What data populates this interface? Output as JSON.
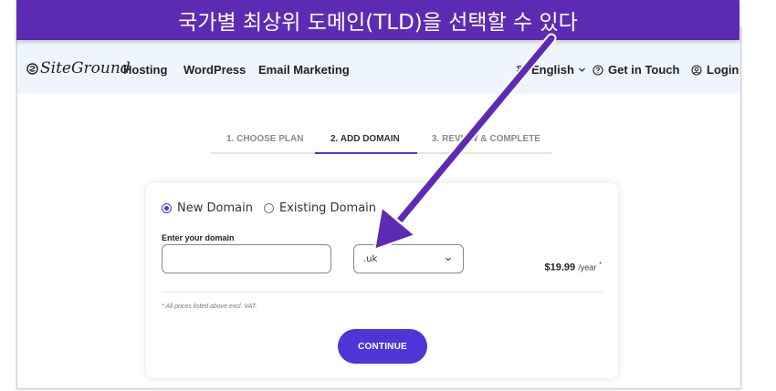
{
  "banner": {
    "text": "국가별 최상위 도메인(TLD)을 선택할 수 있다"
  },
  "nav": {
    "logo_text": "SiteGround",
    "links": [
      "Hosting",
      "WordPress",
      "Email Marketing"
    ],
    "language": "English",
    "contact": "Get in Touch",
    "login": "Login"
  },
  "steps": [
    "1. CHOOSE PLAN",
    "2. ADD DOMAIN",
    "3. REVIEW & COMPLETE"
  ],
  "form": {
    "option_new": "New Domain",
    "option_existing": "Existing Domain",
    "domain_label": "Enter your domain",
    "domain_value": "",
    "tld_value": ".uk",
    "price": "$19.99",
    "price_period": "/year",
    "price_star": "*",
    "vat_note": "* All prices listed above excl. VAT.",
    "continue_label": "CONTINUE"
  },
  "colors": {
    "accent": "#4f35d8",
    "banner": "#5d2bb3",
    "nav_bg": "#eef5fc"
  }
}
